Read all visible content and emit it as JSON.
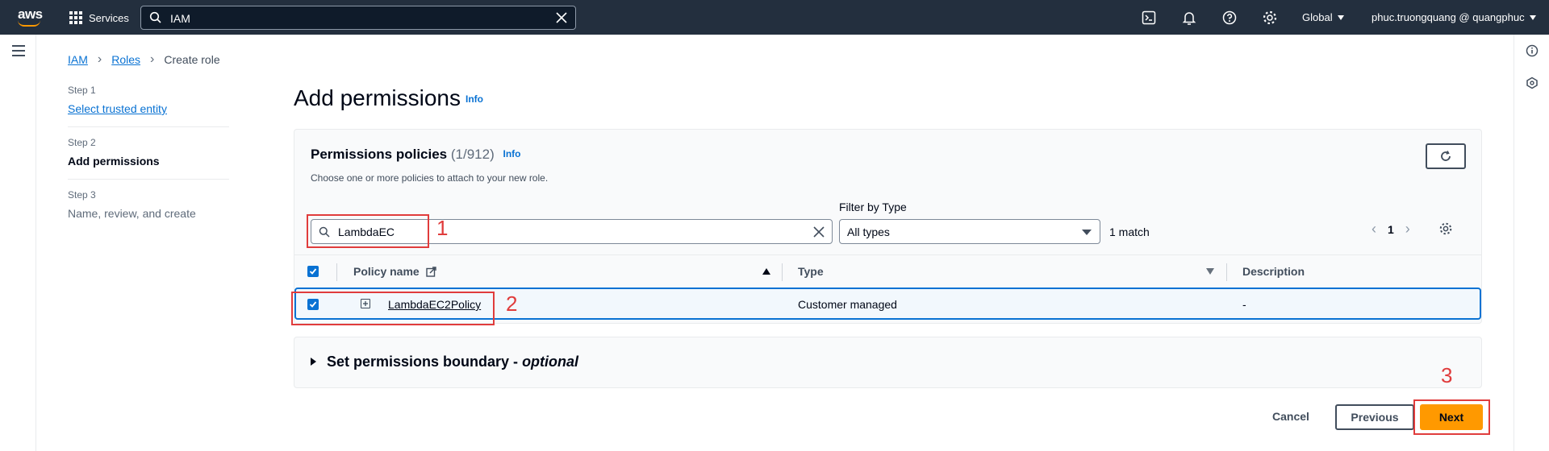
{
  "topnav": {
    "logo": "aws",
    "services_label": "Services",
    "search_value": "IAM",
    "region": "Global",
    "account": "phuc.truongquang @ quangphuc"
  },
  "breadcrumb": {
    "item1": "IAM",
    "item2": "Roles",
    "current": "Create role"
  },
  "steps": [
    {
      "num": "Step 1",
      "label": "Select trusted entity"
    },
    {
      "num": "Step 2",
      "label": "Add permissions"
    },
    {
      "num": "Step 3",
      "label": "Name, review, and create"
    }
  ],
  "page": {
    "title": "Add permissions",
    "info": "Info"
  },
  "policies": {
    "title": "Permissions policies",
    "count": "(1/912)",
    "info": "Info",
    "description": "Choose one or more policies to attach to your new role.",
    "filter_value": "LambdaEC",
    "filter_type_label": "Filter by Type",
    "filter_type_value": "All types",
    "match_text": "1 match",
    "page_number": "1",
    "columns": {
      "name": "Policy name",
      "type": "Type",
      "description": "Description"
    },
    "rows": [
      {
        "name": "LambdaEC2Policy",
        "type": "Customer managed",
        "description": "-",
        "selected": true
      }
    ]
  },
  "boundary": {
    "title": "Set permissions boundary - ",
    "optional": "optional"
  },
  "footer": {
    "cancel": "Cancel",
    "previous": "Previous",
    "next": "Next"
  },
  "annotations": {
    "a1": "1",
    "a2": "2",
    "a3": "3"
  },
  "colors": {
    "nav": "#232f3e",
    "accent": "#ff9900",
    "link": "#0972d3",
    "annotation": "#e03c3c"
  }
}
